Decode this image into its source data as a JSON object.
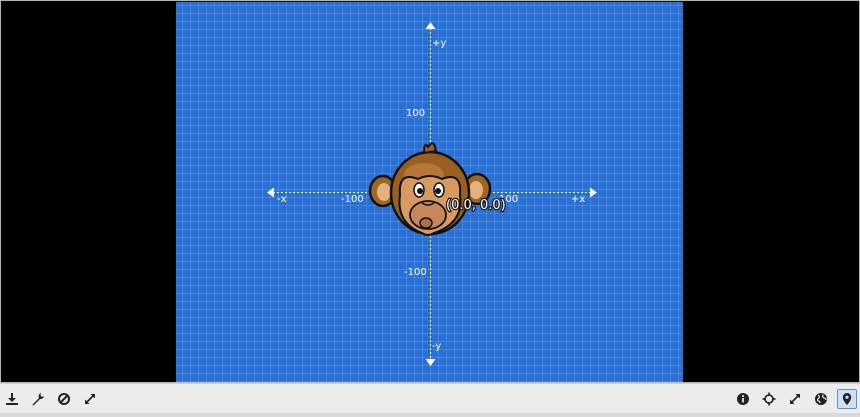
{
  "viewport": {
    "axis_labels": {
      "plus_y": "+y",
      "minus_y": "-y",
      "plus_x": "+x",
      "minus_x": "-x"
    },
    "ticks": {
      "y_pos": "100",
      "y_neg": "-100",
      "x_neg": "-100",
      "x_pos": "100"
    },
    "origin_label": "(0.0, 0.0)",
    "sprite": "monkey-head",
    "colors": {
      "background": "#2a6fd3",
      "letterbox": "#000000"
    }
  },
  "toolbar": {
    "left_icons": [
      "download-icon",
      "wrench-icon",
      "disable-icon",
      "expand-icon"
    ],
    "right_icons": [
      "info-icon",
      "crosshair-icon",
      "fullscreen-icon",
      "globe-icon",
      "location-pin-icon"
    ],
    "active": "location-pin-icon"
  }
}
